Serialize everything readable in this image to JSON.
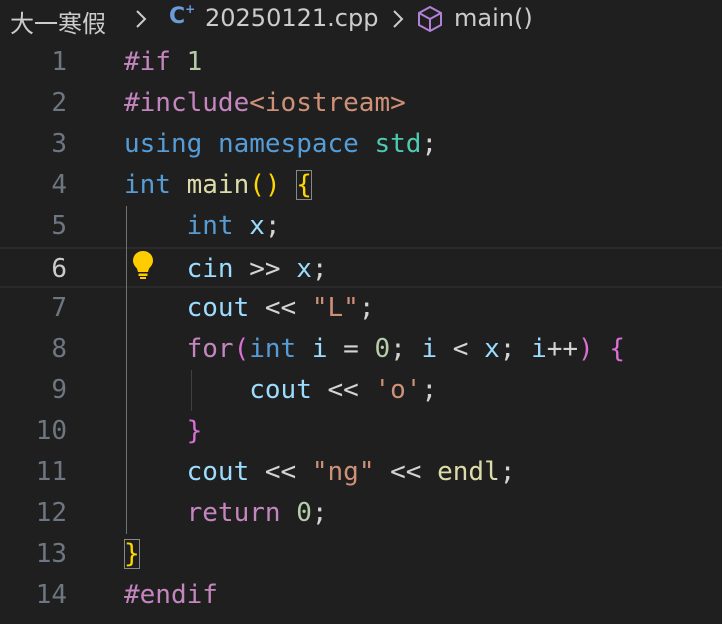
{
  "breadcrumb": {
    "folder": "大一寒假",
    "file": "20250121.cpp",
    "file_icon": "cpp-file-icon",
    "symbol": "main()",
    "symbol_icon": "cube-symbol-icon"
  },
  "editor": {
    "active_line": 6,
    "lines": [
      {
        "num": "1",
        "tokens": [
          {
            "t": "#if",
            "c": "pre"
          },
          {
            "t": " ",
            "c": "op"
          },
          {
            "t": "1",
            "c": "num"
          }
        ]
      },
      {
        "num": "2",
        "tokens": [
          {
            "t": "#include",
            "c": "pre"
          },
          {
            "t": "<iostream>",
            "c": "str"
          }
        ]
      },
      {
        "num": "3",
        "tokens": [
          {
            "t": "using",
            "c": "kw"
          },
          {
            "t": " ",
            "c": "op"
          },
          {
            "t": "namespace",
            "c": "kw"
          },
          {
            "t": " ",
            "c": "op"
          },
          {
            "t": "std",
            "c": "ns"
          },
          {
            "t": ";",
            "c": "op"
          }
        ]
      },
      {
        "num": "4",
        "tokens": [
          {
            "t": "int",
            "c": "kw"
          },
          {
            "t": " ",
            "c": "op"
          },
          {
            "t": "main",
            "c": "fn"
          },
          {
            "t": "()",
            "c": "br1"
          },
          {
            "t": " ",
            "c": "op"
          },
          {
            "t": "{",
            "c": "br1 box"
          }
        ]
      },
      {
        "num": "5",
        "tokens": [
          {
            "t": "    ",
            "c": "op"
          },
          {
            "t": "int",
            "c": "kw"
          },
          {
            "t": " ",
            "c": "op"
          },
          {
            "t": "x",
            "c": "var"
          },
          {
            "t": ";",
            "c": "op"
          }
        ]
      },
      {
        "num": "6",
        "tokens": [
          {
            "t": "    ",
            "c": "op"
          },
          {
            "t": "cin",
            "c": "var"
          },
          {
            "t": " >> ",
            "c": "op"
          },
          {
            "t": "x",
            "c": "var"
          },
          {
            "t": ";",
            "c": "op"
          }
        ]
      },
      {
        "num": "7",
        "tokens": [
          {
            "t": "    ",
            "c": "op"
          },
          {
            "t": "cout",
            "c": "var"
          },
          {
            "t": " << ",
            "c": "op"
          },
          {
            "t": "\"L\"",
            "c": "str"
          },
          {
            "t": ";",
            "c": "op"
          }
        ]
      },
      {
        "num": "8",
        "tokens": [
          {
            "t": "    ",
            "c": "op"
          },
          {
            "t": "for",
            "c": "ctl"
          },
          {
            "t": "(",
            "c": "br2"
          },
          {
            "t": "int",
            "c": "kw"
          },
          {
            "t": " ",
            "c": "op"
          },
          {
            "t": "i",
            "c": "var"
          },
          {
            "t": " = ",
            "c": "op"
          },
          {
            "t": "0",
            "c": "num"
          },
          {
            "t": "; ",
            "c": "op"
          },
          {
            "t": "i",
            "c": "var"
          },
          {
            "t": " < ",
            "c": "op"
          },
          {
            "t": "x",
            "c": "var"
          },
          {
            "t": "; ",
            "c": "op"
          },
          {
            "t": "i",
            "c": "var"
          },
          {
            "t": "++",
            "c": "op"
          },
          {
            "t": ")",
            "c": "br2"
          },
          {
            "t": " ",
            "c": "op"
          },
          {
            "t": "{",
            "c": "br2"
          }
        ]
      },
      {
        "num": "9",
        "tokens": [
          {
            "t": "        ",
            "c": "op"
          },
          {
            "t": "cout",
            "c": "var"
          },
          {
            "t": " << ",
            "c": "op"
          },
          {
            "t": "'o'",
            "c": "str"
          },
          {
            "t": ";",
            "c": "op"
          }
        ]
      },
      {
        "num": "10",
        "tokens": [
          {
            "t": "    ",
            "c": "op"
          },
          {
            "t": "}",
            "c": "br2"
          }
        ]
      },
      {
        "num": "11",
        "tokens": [
          {
            "t": "    ",
            "c": "op"
          },
          {
            "t": "cout",
            "c": "var"
          },
          {
            "t": " << ",
            "c": "op"
          },
          {
            "t": "\"ng\"",
            "c": "str"
          },
          {
            "t": " << ",
            "c": "op"
          },
          {
            "t": "endl",
            "c": "fn"
          },
          {
            "t": ";",
            "c": "op"
          }
        ]
      },
      {
        "num": "12",
        "tokens": [
          {
            "t": "    ",
            "c": "op"
          },
          {
            "t": "return",
            "c": "ctl"
          },
          {
            "t": " ",
            "c": "op"
          },
          {
            "t": "0",
            "c": "num"
          },
          {
            "t": ";",
            "c": "op"
          }
        ]
      },
      {
        "num": "13",
        "tokens": [
          {
            "t": "}",
            "c": "br1 box"
          }
        ]
      },
      {
        "num": "14",
        "tokens": [
          {
            "t": "#endif",
            "c": "pre"
          }
        ]
      }
    ],
    "lightbulb_icon": "lightbulb-icon"
  },
  "colors": {
    "background": "#1f1f1f",
    "keyword": "#569cd6",
    "control": "#c586c0",
    "string": "#ce9178",
    "function": "#dcdcaa",
    "variable": "#9cdcfe",
    "namespace": "#4ec9b0",
    "number": "#b5cea8",
    "bracket_1": "#ffd700",
    "bracket_2": "#da70d6",
    "lightbulb": "#ffcc00"
  }
}
